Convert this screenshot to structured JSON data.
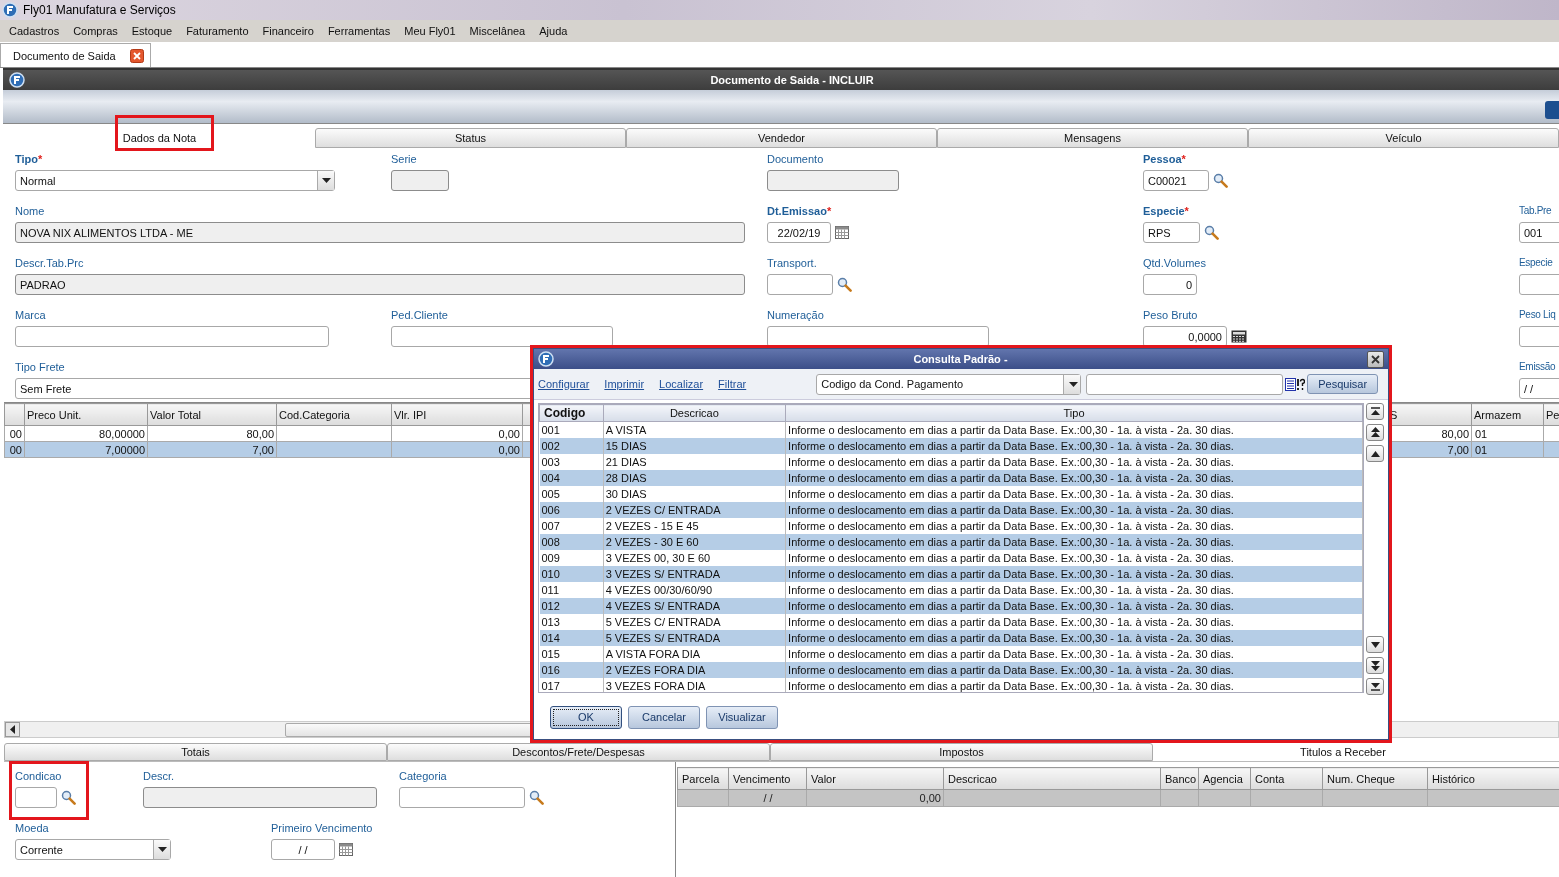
{
  "window": {
    "title": "Fly01 Manufatura e Serviços"
  },
  "menu": [
    "Cadastros",
    "Compras",
    "Estoque",
    "Faturamento",
    "Financeiro",
    "Ferramentas",
    "Meu Fly01",
    "Miscelânea",
    "Ajuda"
  ],
  "doc_tabs": [
    {
      "label": "Documento de Saida",
      "selected": true
    }
  ],
  "form_title": "Documento de Saida - INCLUIR",
  "required_mark": "*",
  "tabs": [
    {
      "label": "Dados da Nota",
      "selected": true
    },
    {
      "label": "Status",
      "selected": false
    },
    {
      "label": "Vendedor",
      "selected": false
    },
    {
      "label": "Mensagens",
      "selected": false
    },
    {
      "label": "Veículo",
      "selected": false
    }
  ],
  "fields": [
    {
      "label": "Tipo",
      "required": true,
      "kind": "select",
      "value": "Normal"
    },
    {
      "label": "Serie",
      "required": false,
      "kind": "readonly"
    },
    {
      "label": "Documento",
      "required": false,
      "kind": "readonly"
    },
    {
      "label": "Pessoa",
      "required": true,
      "kind": "lookup",
      "value": "C00021"
    },
    {
      "label": "Nome",
      "required": false,
      "kind": "readonly",
      "value": "NOVA NIX ALIMENTOS LTDA - ME"
    },
    {
      "label": "Dt.Emissao",
      "required": true,
      "kind": "date",
      "value": "22/02/19"
    },
    {
      "label": "Especie",
      "required": true,
      "kind": "lookup",
      "value": "RPS"
    },
    {
      "label": "Tab.Pre",
      "required": false,
      "kind": "text",
      "value": "001"
    },
    {
      "label": "Descr.Tab.Prc",
      "required": false,
      "kind": "readonly",
      "value": "PADRAO"
    },
    {
      "label": "Transport.",
      "required": false,
      "kind": "lookup"
    },
    {
      "label": "Qtd.Volumes",
      "required": false,
      "kind": "number",
      "value": "0"
    },
    {
      "label": "Especie",
      "required": false,
      "kind": "text"
    },
    {
      "label": "Marca",
      "required": false,
      "kind": "text"
    },
    {
      "label": "Ped.Cliente",
      "required": false,
      "kind": "text"
    },
    {
      "label": "Numeração",
      "required": false,
      "kind": "text"
    },
    {
      "label": "Peso Bruto",
      "required": false,
      "kind": "measure",
      "value": "0,0000"
    },
    {
      "label": "Peso Liq",
      "required": false,
      "kind": "text"
    },
    {
      "label": "Tipo Frete",
      "required": false,
      "kind": "text",
      "value": "Sem Frete"
    },
    {
      "label": "Emissão",
      "required": false,
      "kind": "text",
      "value": "/ /"
    }
  ],
  "items_table": {
    "columns": [
      null,
      "Preco Unit.",
      "Valor Total",
      "Cod.Categoria",
      "Vlr. IPI",
      null,
      "S",
      "Armazem",
      "Pe"
    ],
    "rows": [
      {
        "selected": false,
        "cells": [
          "00",
          "80,00000",
          "80,00",
          null,
          "0,00",
          null,
          "80,00",
          "01",
          null
        ]
      },
      {
        "selected": true,
        "cells": [
          "00",
          "7,00000",
          "7,00",
          null,
          "0,00",
          null,
          "7,00",
          "01",
          null
        ]
      }
    ]
  },
  "dialog": {
    "title": "Consulta Padrão -",
    "links": [
      "Configurar",
      "Imprimir",
      "Localizar",
      "Filtrar"
    ],
    "search_by": "Codigo da Cond. Pagamento",
    "search_button": "Pesquisar",
    "columns": [
      "Codigo",
      "Descricao",
      "Tipo"
    ],
    "rows": [
      [
        "001",
        "A VISTA",
        "Informe o deslocamento em dias a partir da Data Base. Ex.:00,30 - 1a. à vista - 2a. 30 dias."
      ],
      [
        "002",
        "15 DIAS",
        "Informe o deslocamento em dias a partir da Data Base. Ex.:00,30 - 1a. à vista - 2a. 30 dias."
      ],
      [
        "003",
        "21 DIAS",
        "Informe o deslocamento em dias a partir da Data Base. Ex.:00,30 - 1a. à vista - 2a. 30 dias."
      ],
      [
        "004",
        "28 DIAS",
        "Informe o deslocamento em dias a partir da Data Base. Ex.:00,30 - 1a. à vista - 2a. 30 dias."
      ],
      [
        "005",
        "30 DIAS",
        "Informe o deslocamento em dias a partir da Data Base. Ex.:00,30 - 1a. à vista - 2a. 30 dias."
      ],
      [
        "006",
        "2 VEZES C/ ENTRADA",
        "Informe o deslocamento em dias a partir da Data Base. Ex.:00,30 - 1a. à vista - 2a. 30 dias."
      ],
      [
        "007",
        "2 VEZES - 15 E 45",
        "Informe o deslocamento em dias a partir da Data Base. Ex.:00,30 - 1a. à vista - 2a. 30 dias."
      ],
      [
        "008",
        "2 VEZES - 30 E 60",
        "Informe o deslocamento em dias a partir da Data Base. Ex.:00,30 - 1a. à vista - 2a. 30 dias."
      ],
      [
        "009",
        "3 VEZES 00, 30 E 60",
        "Informe o deslocamento em dias a partir da Data Base. Ex.:00,30 - 1a. à vista - 2a. 30 dias."
      ],
      [
        "010",
        "3 VEZES S/ ENTRADA",
        "Informe o deslocamento em dias a partir da Data Base. Ex.:00,30 - 1a. à vista - 2a. 30 dias."
      ],
      [
        "011",
        "4 VEZES 00/30/60/90",
        "Informe o deslocamento em dias a partir da Data Base. Ex.:00,30 - 1a. à vista - 2a. 30 dias."
      ],
      [
        "012",
        "4 VEZES S/ ENTRADA",
        "Informe o deslocamento em dias a partir da Data Base. Ex.:00,30 - 1a. à vista - 2a. 30 dias."
      ],
      [
        "013",
        "5 VEZES C/ ENTRADA",
        "Informe o deslocamento em dias a partir da Data Base. Ex.:00,30 - 1a. à vista - 2a. 30 dias."
      ],
      [
        "014",
        "5 VEZES S/ ENTRADA",
        "Informe o deslocamento em dias a partir da Data Base. Ex.:00,30 - 1a. à vista - 2a. 30 dias."
      ],
      [
        "015",
        "A VISTA FORA DIA",
        "Informe o deslocamento em dias a partir da Data Base. Ex.:00,30 - 1a. à vista - 2a. 30 dias."
      ],
      [
        "016",
        "2 VEZES FORA DIA",
        "Informe o deslocamento em dias a partir da Data Base. Ex.:00,30 - 1a. à vista - 2a. 30 dias."
      ],
      [
        "017",
        "3 VEZES FORA DIA",
        "Informe o deslocamento em dias a partir da Data Base. Ex.:00,30 - 1a. à vista - 2a. 30 dias."
      ]
    ],
    "buttons": [
      {
        "label": "OK",
        "focused": true
      },
      {
        "label": "Cancelar",
        "focused": false
      },
      {
        "label": "Visualizar",
        "focused": false
      }
    ]
  },
  "bottom_tabs": [
    {
      "label": "Totais",
      "selected": false
    },
    {
      "label": "Descontos/Frete/Despesas",
      "selected": false
    },
    {
      "label": "Impostos",
      "selected": false
    },
    {
      "label": "Titulos a Receber",
      "selected": true
    }
  ],
  "bottom_fields": [
    {
      "label": "Condicao",
      "required": false,
      "kind": "lookup"
    },
    {
      "label": "Descr.",
      "required": false,
      "kind": "readonly"
    },
    {
      "label": "Categoria",
      "required": false,
      "kind": "lookup"
    },
    {
      "label": "Moeda",
      "required": false,
      "kind": "select",
      "value": "Corrente"
    },
    {
      "label": "Primeiro Vencimento",
      "required": false,
      "kind": "date",
      "value": "/ /"
    }
  ],
  "titulos_table": {
    "columns": [
      "Parcela",
      "Vencimento",
      "Valor",
      "Descricao",
      "Banco",
      "Agencia",
      "Conta",
      "Num. Cheque",
      "Histórico"
    ],
    "rows": [
      {
        "cells": [
          null,
          "/ /",
          "0,00",
          null,
          null,
          null,
          null,
          null,
          null
        ]
      }
    ]
  }
}
